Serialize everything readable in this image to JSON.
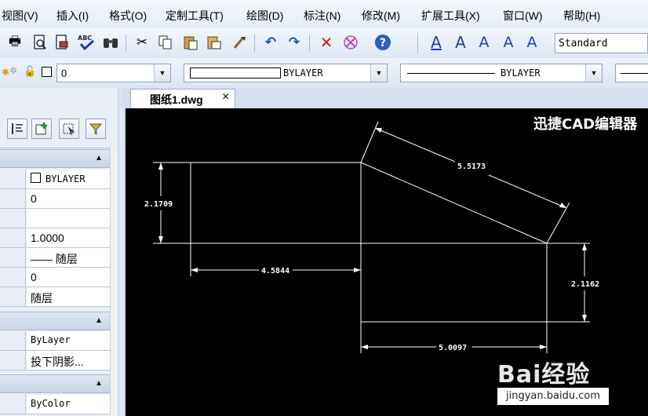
{
  "menu": [
    "视图(V)",
    "插入(I)",
    "格式(O)",
    "定制工具(T)",
    "绘图(D)",
    "标注(N)",
    "修改(M)",
    "扩展工具(X)",
    "窗口(W)",
    "帮助(H)"
  ],
  "toolbar": {
    "text_style": "Standard",
    "icons": [
      "print-icon",
      "print-preview-icon",
      "plot-icon",
      "publish-icon",
      "spell-check-icon",
      "find-icon",
      "cut-icon",
      "copy-icon",
      "paste-icon",
      "paste-special-icon",
      "match-properties-icon",
      "undo-icon",
      "redo-icon",
      "delete-icon",
      "purge-icon",
      "help-icon",
      "text-style-icon",
      "single-line-text-icon",
      "edit-text-icon",
      "find-text-icon",
      "scale-text-icon"
    ],
    "spell_label": "ABC"
  },
  "properties_bar": {
    "layer_value": "0",
    "color_value": "BYLAYER",
    "linetype_value": "BYLAYER"
  },
  "document_tab": {
    "label": "图纸1.dwg",
    "close_glyph": "×"
  },
  "canvas": {
    "title": "迅捷CAD编辑器",
    "dimensions": [
      "2.1709",
      "4.5844",
      "5.5173",
      "2.1162",
      "5.0097"
    ]
  },
  "properties_panel": {
    "general": [
      "BYLAYER",
      "0",
      "",
      "1.0000",
      "—— 随层",
      "0",
      "随层"
    ],
    "section2": [
      "ByLayer",
      "投下阴影..."
    ],
    "section3": [
      "ByColor"
    ]
  },
  "watermark": {
    "logo": "Bai经验",
    "url": "jingyan.baidu.com"
  },
  "colors": {
    "canvas_bg": "#000000",
    "drawing_lines": "#ffffff",
    "panel_bg": "#e9eef6",
    "chrome_bg": "#d6e2f2"
  }
}
